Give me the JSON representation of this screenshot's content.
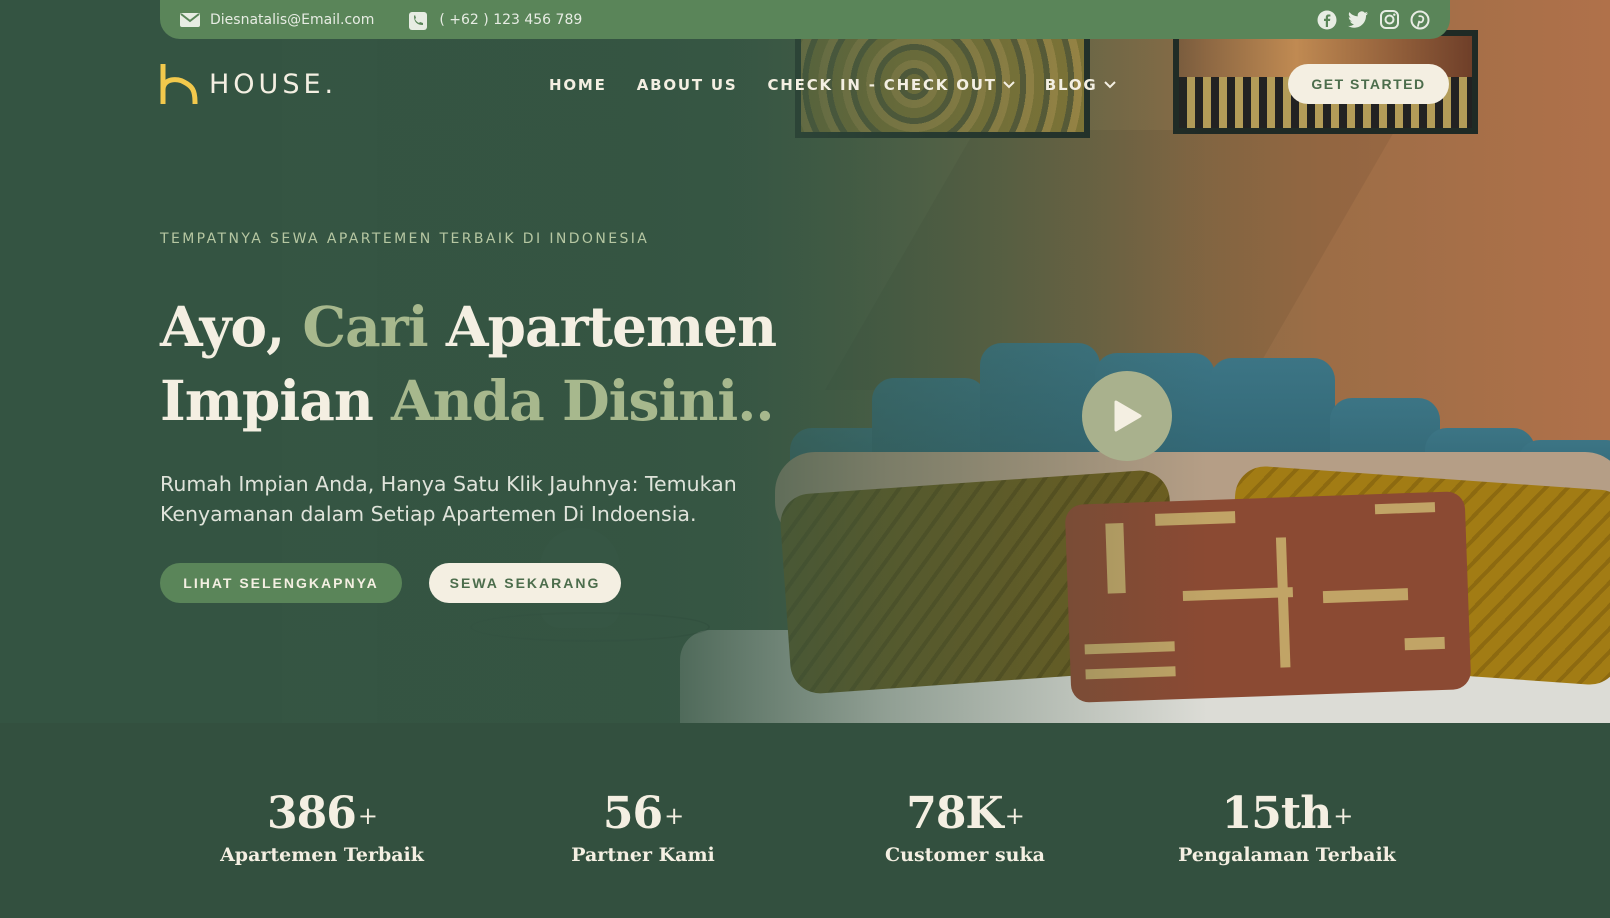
{
  "topbar": {
    "email": "Diesnatalis@Email.com",
    "phone": "( +62 ) 123 456 789",
    "social": [
      "facebook-icon",
      "twitter-icon",
      "instagram-icon",
      "pinterest-icon"
    ]
  },
  "brand": {
    "name": "HOUSE.",
    "logo_color": "#f2c94c"
  },
  "nav": {
    "items": [
      {
        "label": "HOME",
        "dropdown": false
      },
      {
        "label": "ABOUT US",
        "dropdown": false
      },
      {
        "label": "CHECK IN - CHECK OUT",
        "dropdown": true
      },
      {
        "label": "BLOG",
        "dropdown": true
      }
    ],
    "cta": "GET STARTED"
  },
  "hero": {
    "tagline": "TEMPATNYA SEWA APARTEMEN TERBAIK DI INDONESIA",
    "headline": {
      "part1": "Ayo, ",
      "part2": "Cari",
      "part3": " Apartemen",
      "part4": "Impian ",
      "part5": "Anda Disini.."
    },
    "subtext": "Rumah Impian Anda, Hanya Satu Klik Jauhnya: Temukan Kenyamanan dalam Setiap Apartemen Di Indoensia.",
    "primary_button": "LIHAT SELENGKAPNYA",
    "secondary_button": "SEWA SEKARANG"
  },
  "stats": [
    {
      "value": "386",
      "suffix": "+",
      "label": "Apartemen Terbaik"
    },
    {
      "value": "56",
      "suffix": "+",
      "label": "Partner Kami"
    },
    {
      "value": "78K",
      "suffix": "+",
      "label": "Customer suka"
    },
    {
      "value": "15th",
      "suffix": "+",
      "label": "Pengalaman Terbaik"
    }
  ],
  "colors": {
    "primary_green": "#5a8559",
    "dark_green": "#33503f",
    "cream": "#f4efe2",
    "accent_sage": "#a7b88d"
  }
}
